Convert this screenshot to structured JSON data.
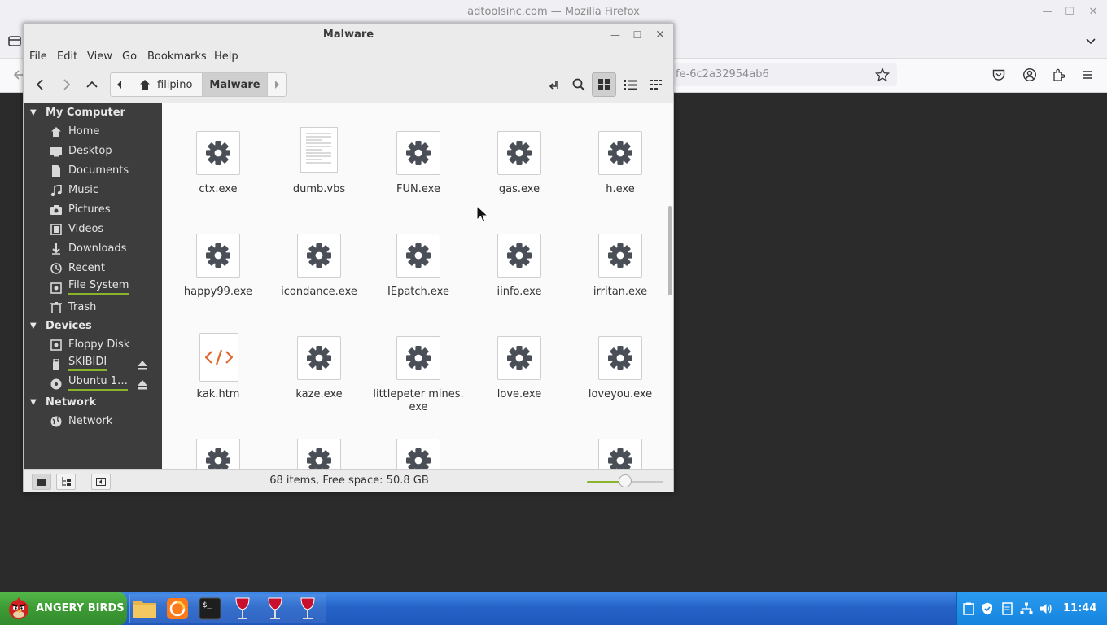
{
  "firefox": {
    "window_title": "adtoolsinc.com — Mozilla Firefox",
    "url_fragment": "fe-6c2a32954ab6"
  },
  "nemo": {
    "title": "Malware",
    "menu": [
      "File",
      "Edit",
      "View",
      "Go",
      "Bookmarks",
      "Help"
    ],
    "path": {
      "home_label": "filipino",
      "current_label": "Malware"
    },
    "sidebar": {
      "sections": [
        {
          "label": "My Computer",
          "items": [
            {
              "label": "Home",
              "icon": "home-icon"
            },
            {
              "label": "Desktop",
              "icon": "desktop-icon"
            },
            {
              "label": "Documents",
              "icon": "documents-icon"
            },
            {
              "label": "Music",
              "icon": "music-icon"
            },
            {
              "label": "Pictures",
              "icon": "pictures-icon"
            },
            {
              "label": "Videos",
              "icon": "videos-icon"
            },
            {
              "label": "Downloads",
              "icon": "downloads-icon"
            },
            {
              "label": "Recent",
              "icon": "recent-icon"
            },
            {
              "label": "File System",
              "icon": "drive-icon"
            },
            {
              "label": "Trash",
              "icon": "trash-icon"
            }
          ]
        },
        {
          "label": "Devices",
          "items": [
            {
              "label": "Floppy Disk",
              "icon": "drive-icon"
            },
            {
              "label": "SKIBIDI",
              "icon": "usb-icon"
            },
            {
              "label": "Ubuntu 1…",
              "icon": "disc-icon"
            }
          ]
        },
        {
          "label": "Network",
          "items": [
            {
              "label": "Network",
              "icon": "network-icon"
            }
          ]
        }
      ]
    },
    "files": [
      {
        "name": "ctx.exe",
        "icon": "gear-icon"
      },
      {
        "name": "dumb.vbs",
        "icon": "text-file-icon"
      },
      {
        "name": "FUN.exe",
        "icon": "gear-icon"
      },
      {
        "name": "gas.exe",
        "icon": "gear-icon"
      },
      {
        "name": "h.exe",
        "icon": "gear-icon"
      },
      {
        "name": "happy99.exe",
        "icon": "gear-icon"
      },
      {
        "name": "icondance.exe",
        "icon": "gear-icon"
      },
      {
        "name": "IEpatch.exe",
        "icon": "gear-icon"
      },
      {
        "name": "iinfo.exe",
        "icon": "gear-icon"
      },
      {
        "name": "irritan.exe",
        "icon": "gear-icon"
      },
      {
        "name": "kak.htm",
        "icon": "html-file-icon"
      },
      {
        "name": "kaze.exe",
        "icon": "gear-icon"
      },
      {
        "name": "littlepeter mines.\nexe",
        "icon": "gear-icon"
      },
      {
        "name": "love.exe",
        "icon": "gear-icon"
      },
      {
        "name": "loveyou.exe",
        "icon": "gear-icon"
      }
    ],
    "status": "68 items, Free space: 50.8 GB",
    "zoom_fraction": 0.5
  },
  "taskbar": {
    "start_label": "ANGERY BIRDS",
    "clock": "11:44"
  },
  "colors": {
    "accent_green": "#8ab42c",
    "sidebar_bg": "#3d3d3d",
    "taskbar_blue": "#2563c8",
    "start_green": "#3c9a34",
    "html_icon_orange": "#e0672c"
  }
}
